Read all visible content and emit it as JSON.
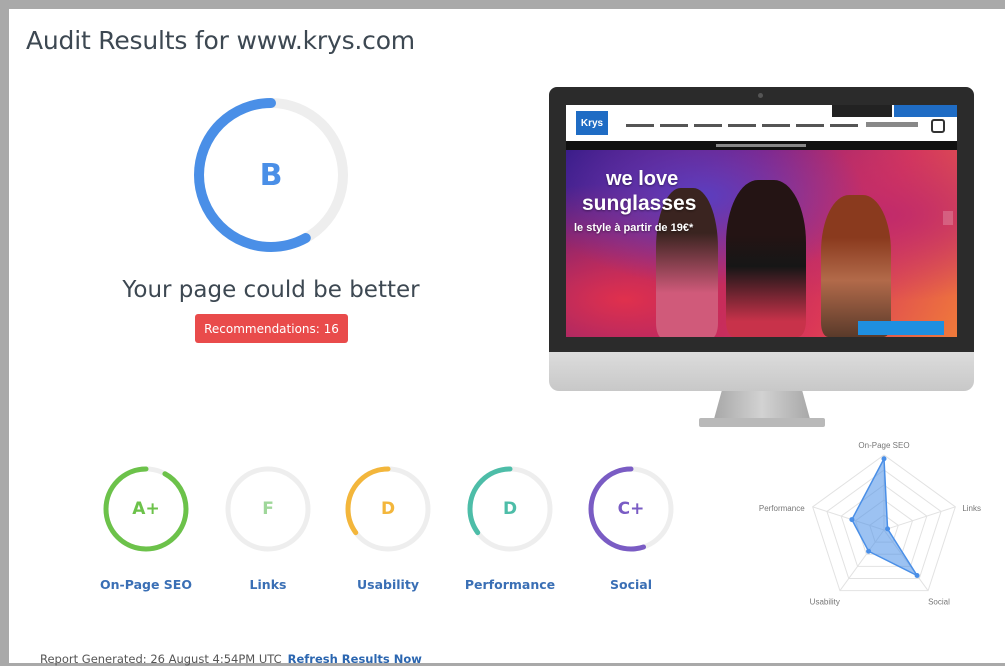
{
  "header": {
    "title": "Audit Results for www.krys.com"
  },
  "overall": {
    "grade": "B",
    "score_fraction": 0.58,
    "headline": "Your page could be better",
    "recommendations_label": "Recommendations: 16"
  },
  "preview": {
    "brand": "Krys",
    "hero_line1": "we love",
    "hero_line2": "sunglasses",
    "hero_line3": "le style à partir de 19€*"
  },
  "categories": [
    {
      "grade": "A+",
      "label": "On-Page SEO",
      "fraction": 0.92,
      "color": "#6cc24a"
    },
    {
      "grade": "F",
      "label": "Links",
      "fraction": 0.0,
      "color": "#9fd79a"
    },
    {
      "grade": "D",
      "label": "Usability",
      "fraction": 0.35,
      "color": "#f3b63b"
    },
    {
      "grade": "D",
      "label": "Performance",
      "fraction": 0.35,
      "color": "#4dbda8"
    },
    {
      "grade": "C+",
      "label": "Social",
      "fraction": 0.55,
      "color": "#7a5cc4"
    }
  ],
  "radar": {
    "axes": [
      "On-Page SEO",
      "Links",
      "Social",
      "Usability",
      "Performance"
    ],
    "values": [
      0.95,
      0.05,
      0.75,
      0.35,
      0.45
    ]
  },
  "footer": {
    "generated": "Report Generated: 26 August 4:54PM UTC",
    "refresh_label": "Refresh Results Now"
  },
  "colors": {
    "primary": "#4a8fe7",
    "danger": "#e94b4b",
    "track": "#eeeeee"
  }
}
